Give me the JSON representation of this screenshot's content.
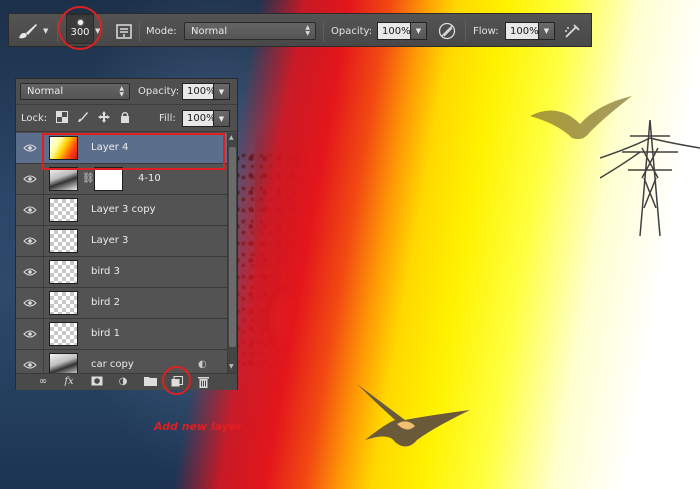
{
  "options_bar": {
    "brush_size": "300",
    "mode_label": "Mode:",
    "mode_value": "Normal",
    "opacity_label": "Opacity:",
    "opacity_value": "100%",
    "flow_label": "Flow:",
    "flow_value": "100%"
  },
  "layers_panel": {
    "blend_mode": "Normal",
    "opacity_label": "Opacity:",
    "opacity_value": "100%",
    "lock_label": "Lock:",
    "fill_label": "Fill:",
    "fill_value": "100%",
    "layers": [
      {
        "name": "Layer 4",
        "thumb": "gradient",
        "selected": true
      },
      {
        "name": "4-10",
        "thumb": "photo",
        "mask": true
      },
      {
        "name": "Layer 3 copy",
        "thumb": "transparent"
      },
      {
        "name": "Layer 3",
        "thumb": "transparent"
      },
      {
        "name": "bird 3",
        "thumb": "transparent"
      },
      {
        "name": "bird 2",
        "thumb": "transparent"
      },
      {
        "name": "bird 1",
        "thumb": "transparent"
      },
      {
        "name": "car copy",
        "thumb": "photo"
      }
    ],
    "footer_icons": [
      "link-icon",
      "fx-icon",
      "mask-icon",
      "adjustment-icon",
      "folder-icon",
      "new-layer-icon",
      "trash-icon"
    ]
  },
  "annotation": {
    "caption": "Add new layer",
    "highlight_color": "#e02020"
  },
  "colors": {
    "selected_row": "#5b6f8c",
    "panel_bg": "#4f4f4f"
  }
}
